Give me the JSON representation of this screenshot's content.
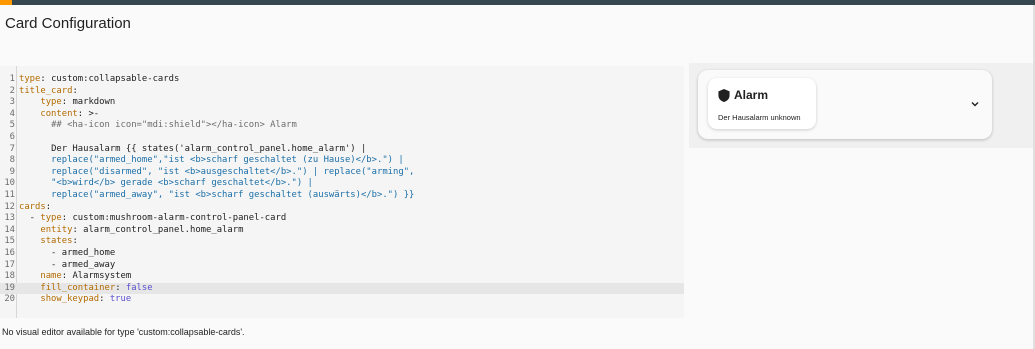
{
  "header": {
    "title": "Card Configuration"
  },
  "colors": {
    "topbar": "#37474f",
    "topbar_accent": "#ff9800",
    "yaml_key": "#b36b00",
    "yaml_string": "#1b6fa8",
    "yaml_bool": "#5a4fcf",
    "editor_bg": "#f5f5f5",
    "preview_bg": "#f0f0f0"
  },
  "editor": {
    "active_line": 19,
    "lines": [
      {
        "num": "1",
        "key": "type",
        "sep": ": ",
        "val": "custom:collapsable-cards",
        "vclass": "p"
      },
      {
        "num": "2",
        "key": "title_card",
        "sep": ":",
        "val": "",
        "vclass": "p"
      },
      {
        "num": "3",
        "indent": "    ",
        "key": "type",
        "sep": ": ",
        "val": "markdown",
        "vclass": "p"
      },
      {
        "num": "4",
        "indent": "    ",
        "key": "content",
        "sep": ": ",
        "val": ">-",
        "vclass": "p"
      },
      {
        "num": "5",
        "indent": "      ",
        "val": "## <ha-icon icon=\"mdi:shield\"></ha-icon> Alarm",
        "vclass": "c"
      },
      {
        "num": "6",
        "val": ""
      },
      {
        "num": "7",
        "indent": "      ",
        "val": "Der Hausalarm {{ states('alarm_control_panel.home_alarm') |",
        "vclass": "p"
      },
      {
        "num": "8",
        "indent": "      ",
        "val": "replace(\"armed_home\",\"ist <b>scharf geschaltet (zu Hause)</b>.\") |",
        "vclass": "s"
      },
      {
        "num": "9",
        "indent": "      ",
        "val": "replace(\"disarmed\", \"ist <b>ausgeschaltet</b>.\") | replace(\"arming\",",
        "vclass": "s"
      },
      {
        "num": "10",
        "indent": "      ",
        "val": "\"<b>wird</b> gerade <b>scharf geschaltet</b>.\") |",
        "vclass": "s"
      },
      {
        "num": "11",
        "indent": "      ",
        "val": "replace(\"armed_away\", \"ist <b>scharf geschaltet (auswärts)</b>.\") }}",
        "vclass": "s"
      },
      {
        "num": "12",
        "key": "cards",
        "sep": ":",
        "val": "",
        "vclass": "p"
      },
      {
        "num": "13",
        "indent": "  - ",
        "key": "type",
        "sep": ": ",
        "val": "custom:mushroom-alarm-control-panel-card",
        "vclass": "p"
      },
      {
        "num": "14",
        "indent": "    ",
        "key": "entity",
        "sep": ": ",
        "val": "alarm_control_panel.home_alarm",
        "vclass": "p"
      },
      {
        "num": "15",
        "indent": "    ",
        "key": "states",
        "sep": ":",
        "val": "",
        "vclass": "p"
      },
      {
        "num": "16",
        "indent": "      - ",
        "val": "armed_home",
        "vclass": "p"
      },
      {
        "num": "17",
        "indent": "      - ",
        "val": "armed_away",
        "vclass": "p"
      },
      {
        "num": "18",
        "indent": "    ",
        "key": "name",
        "sep": ": ",
        "val": "Alarmsystem",
        "vclass": "p"
      },
      {
        "num": "19",
        "indent": "    ",
        "key": "fill_container",
        "sep": ": ",
        "val": "false",
        "vclass": "b"
      },
      {
        "num": "20",
        "indent": "    ",
        "key": "show_keypad",
        "sep": ": ",
        "val": "true",
        "vclass": "b"
      }
    ]
  },
  "footer": {
    "no_visual_editor": "No visual editor available for type 'custom:collapsable-cards'."
  },
  "preview": {
    "title_icon": "shield-icon",
    "title": "Alarm",
    "subtitle": "Der Hausalarm unknown",
    "toggle_icon": "chevron-down-icon"
  }
}
